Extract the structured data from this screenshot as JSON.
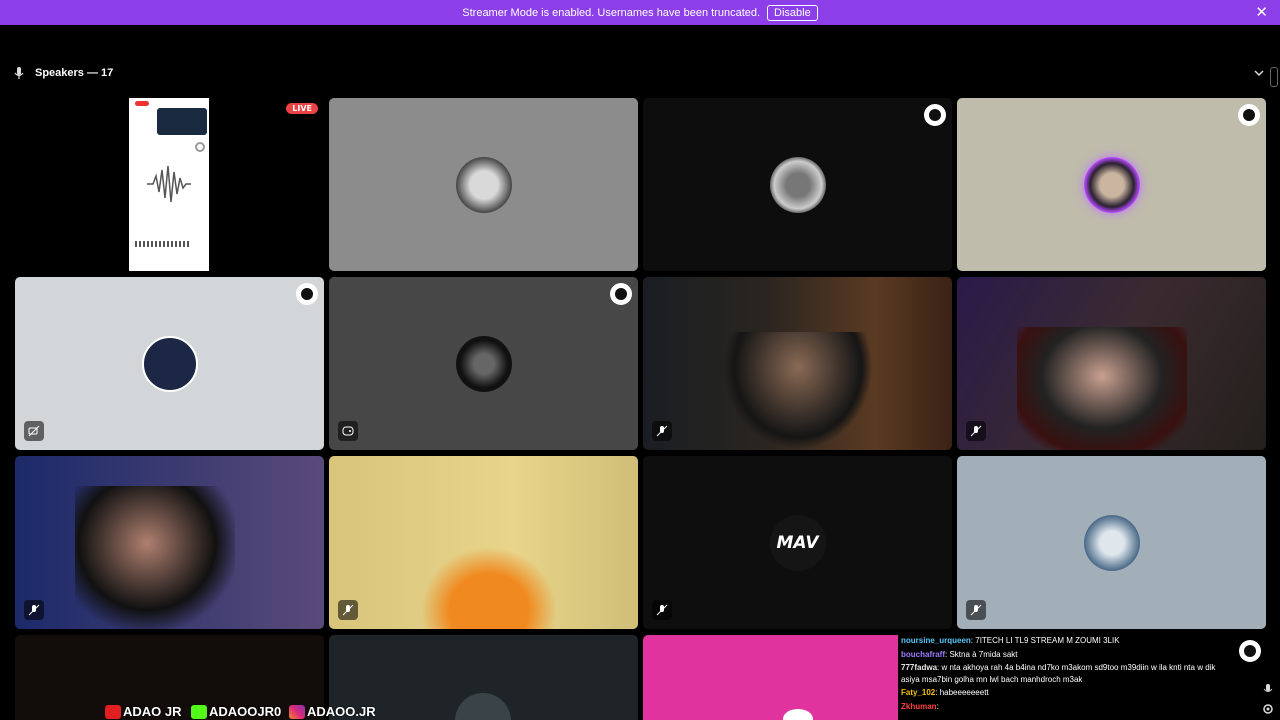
{
  "banner": {
    "message": "Streamer Mode is enabled. Usernames have been truncated.",
    "disable_label": "Disable"
  },
  "section": {
    "title": "Speakers — 17"
  },
  "tiles": {
    "first_live_label": "LIVE",
    "avatar_text_11": "MAV"
  },
  "chat": {
    "lines": [
      {
        "name": "noursine_urqueen",
        "text": "7ITECH LI TL9 STREAM M ZOUMI 3LIK",
        "color": "#5ac8fa"
      },
      {
        "name": "bouchafraff",
        "text": "Sktna à 7mida sakt",
        "color": "#9d7bff"
      },
      {
        "name": "777fadwa",
        "text": "w nta akhoya rah 4a b4ina nd7ko m3akom sd9too m39diin w ila knti nta w dik asiya msa7bin golha mn lwl bach manhdroch m3ak",
        "color": "#e6e6e6"
      },
      {
        "name": "Faty_102",
        "text": "habeeeeeeett",
        "color": "#f5c000"
      },
      {
        "name": "Zkhuman",
        "text": "",
        "color": "#ff4040"
      }
    ]
  },
  "socials": {
    "youtube": "ADAO JR",
    "kick": "ADAOOJR0",
    "instagram": "ADAOO.JR"
  },
  "colors": {
    "banner": "#8c3fe8",
    "live": "#ed4245",
    "pink_tile": "#e0339d"
  }
}
